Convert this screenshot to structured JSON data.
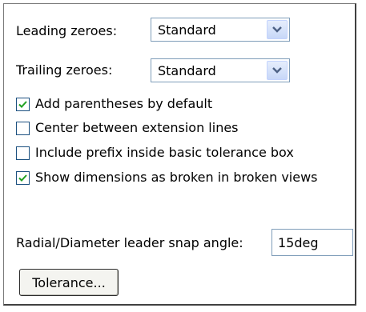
{
  "leading_zeroes": {
    "label": "Leading zeroes:",
    "value": "Standard"
  },
  "trailing_zeroes": {
    "label": "Trailing zeroes:",
    "value": "Standard"
  },
  "options": [
    {
      "label": "Add parentheses by default",
      "checked": true
    },
    {
      "label": "Center between extension lines",
      "checked": false
    },
    {
      "label": "Include prefix inside basic tolerance box",
      "checked": false
    },
    {
      "label": "Show dimensions as broken in broken views",
      "checked": true
    }
  ],
  "snap_angle": {
    "label": "Radial/Diameter leader snap angle:",
    "value": "15deg"
  },
  "tolerance_button": {
    "label": "Tolerance..."
  }
}
